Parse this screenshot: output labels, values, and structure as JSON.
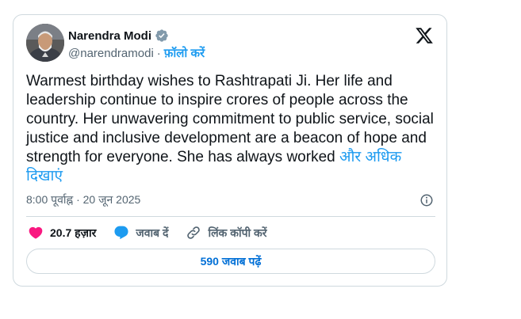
{
  "author": {
    "name": "Narendra Modi",
    "handle": "@narendramodi",
    "separator": "·",
    "follow_label": "फ़ॉलो करें"
  },
  "post": {
    "text": "Warmest birthday wishes to Rashtrapati Ji. Her life and leadership continue to inspire crores of people across the country. Her unwavering commitment to public service, social justice and inclusive development are a beacon of hope and strength for everyone. She has always worked",
    "show_more": "और अधिक दिखाएं",
    "timestamp": "8:00 पूर्वाह्न · 20 जून 2025"
  },
  "actions": {
    "likes": "20.7 हज़ार",
    "reply": "जवाब दें",
    "copy_link": "लिंक कॉपी करें"
  },
  "replies_button": "590 जवाब पढ़ें",
  "colors": {
    "accent": "#1d9bf0",
    "like": "#f91880",
    "text": "#0f1419",
    "muted": "#536471",
    "border": "#cfd9de"
  },
  "icons": [
    "verified-badge-icon",
    "x-logo-icon",
    "info-icon",
    "heart-icon",
    "reply-bubble-icon",
    "link-icon"
  ]
}
